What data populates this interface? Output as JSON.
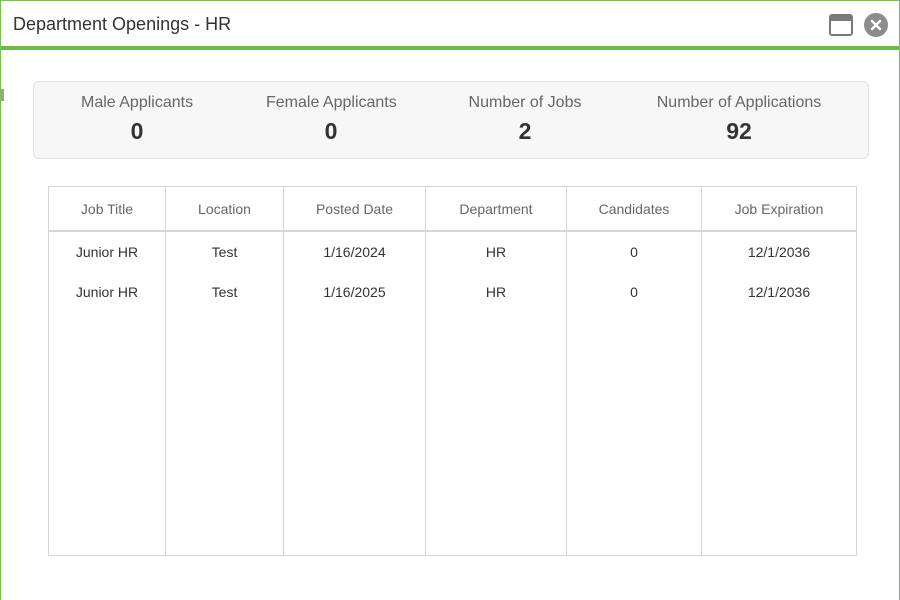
{
  "window": {
    "title": "Department Openings - HR",
    "accent_color": "#6cbb4a",
    "maximize_icon": "window-maximize-icon",
    "close_icon": "close-circle-icon"
  },
  "summary": {
    "male_label": "Male Applicants",
    "male_value": "0",
    "female_label": "Female Applicants",
    "female_value": "0",
    "jobs_label": "Number of Jobs",
    "jobs_value": "2",
    "applications_label": "Number of Applications",
    "applications_value": "92"
  },
  "table": {
    "headers": [
      "Job Title",
      "Location",
      "Posted Date",
      "Department",
      "Candidates",
      "Job Expiration"
    ],
    "rows": [
      [
        "Junior HR",
        "Test",
        "1/16/2024",
        "HR",
        "0",
        "12/1/2036"
      ],
      [
        "Junior HR",
        "Test",
        "1/16/2025",
        "HR",
        "0",
        "12/1/2036"
      ]
    ]
  }
}
